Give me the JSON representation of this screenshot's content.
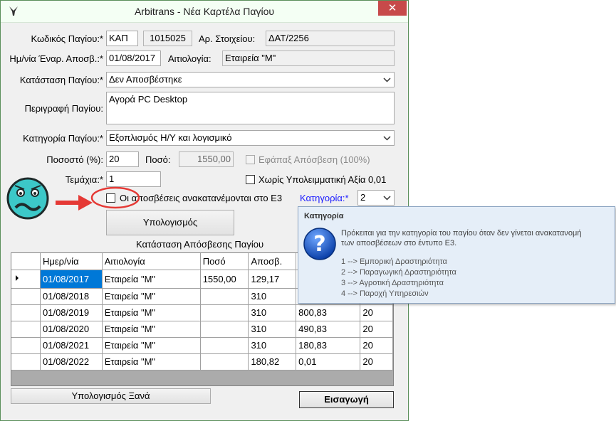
{
  "window": {
    "title": "Arbitrans - Νέα Καρτέλα Παγίου",
    "close_symbol": "✕"
  },
  "form": {
    "code_label": "Κωδικός Παγίου:*",
    "code_prefix": "ΚΑΠ",
    "code_number": "1015025",
    "doc_number_label": "Αρ. Στοιχείου:",
    "doc_number": "ΔΑΤ/2256",
    "start_date_label": "Ημ/νία Έναρ. Αποσβ.:*",
    "start_date": "01/08/2017",
    "reason_label": "Αιτιολογία:",
    "reason": "Εταιρεία \"Μ\"",
    "status_label": "Κατάσταση Παγίου:*",
    "status_value": "Δεν Αποσβέστηκε",
    "description_label": "Περιγραφή Παγίου:",
    "description_value": "Αγορά PC Desktop",
    "category_label": "Κατηγορία Παγίου:*",
    "category_value": "Εξοπλισμός Η/Υ και λογισμικό",
    "percent_label": "Ποσοστό (%):",
    "percent_value": "20",
    "amount_label": "Ποσό:",
    "amount_value": "1550,00",
    "oneoff_label": "Εφάπαξ Απόσβεση (100%)",
    "pieces_label": "Τεμάχια:*",
    "pieces_value": "1",
    "no_residual_label": "Χωρίς Υπολειμματική Αξία 0,01",
    "e3_label": "Οι αποσβέσεις ανακατανέμονται στο Ε3",
    "e3_category_label": "Κατηγορία:*",
    "e3_category_value": "2",
    "calc_button": "Υπολογισμός",
    "grid_title": "Κατάσταση Απόσβεσης Παγίου"
  },
  "grid": {
    "columns": [
      "Ημερ/νία",
      "Αιτιολογία",
      "Ποσό",
      "Αποσβ.",
      "",
      ""
    ],
    "rows": [
      [
        "01/08/2017",
        "Εταιρεία \"Μ\"",
        "1550,00",
        "129,17",
        "",
        ""
      ],
      [
        "01/08/2018",
        "Εταιρεία \"Μ\"",
        "",
        "310",
        "",
        ""
      ],
      [
        "01/08/2019",
        "Εταιρεία \"Μ\"",
        "",
        "310",
        "800,83",
        "20"
      ],
      [
        "01/08/2020",
        "Εταιρεία \"Μ\"",
        "",
        "310",
        "490,83",
        "20"
      ],
      [
        "01/08/2021",
        "Εταιρεία \"Μ\"",
        "",
        "310",
        "180,83",
        "20"
      ],
      [
        "01/08/2022",
        "Εταιρεία \"Μ\"",
        "",
        "180,82",
        "0,01",
        "20"
      ]
    ]
  },
  "footer": {
    "recalc_button": "Υπολογισμός Ξανά",
    "insert_button": "Εισαγωγή"
  },
  "tooltip": {
    "title": "Κατηγορία",
    "body_line1": "Πρόκειται για την κατηγορία του παγίου όταν δεν γίνεται ανακατανομή",
    "body_line2": "των αποσβέσεων στο έντυπο Ε3.",
    "items": [
      "1 --> Εμπορική Δραστηριότητα",
      "2 --> Παραγωγική Δραστηριότητα",
      "3 --> Αγροτική Δραστηριότητα",
      "4 --> Παροχή Υπηρεσιών"
    ]
  },
  "colors": {
    "accent_blue": "#0078d7",
    "annotation_red": "#e53935",
    "category_link_blue": "#1a1aff",
    "face_teal": "#3cc8c8"
  }
}
